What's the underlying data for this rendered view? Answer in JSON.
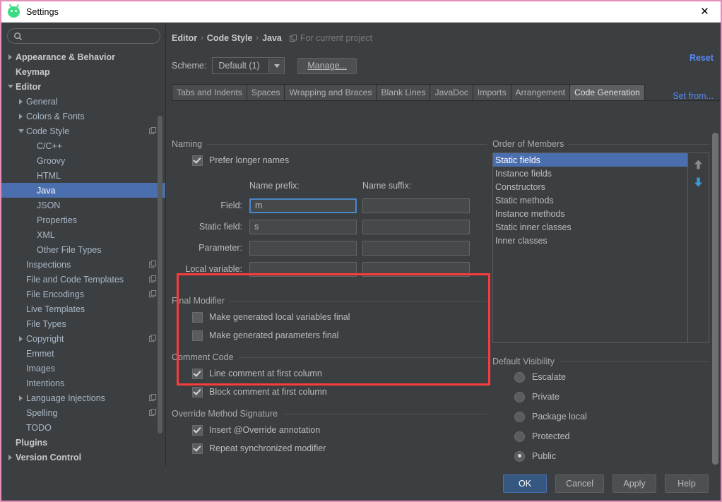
{
  "window": {
    "title": "Settings",
    "app_icon": "android-studio-icon",
    "close_icon": "close-icon",
    "border_color": "#e48fb8"
  },
  "search": {
    "value": "",
    "placeholder": "",
    "icon": "search-icon"
  },
  "sidebar": {
    "items": [
      {
        "label": "Appearance & Behavior",
        "depth": 0,
        "arrow": "collapsed",
        "bold": true,
        "selected": false,
        "badge": false
      },
      {
        "label": "Keymap",
        "depth": 0,
        "arrow": "none",
        "bold": true,
        "selected": false,
        "badge": false
      },
      {
        "label": "Editor",
        "depth": 0,
        "arrow": "expanded",
        "bold": true,
        "selected": false,
        "badge": false
      },
      {
        "label": "General",
        "depth": 1,
        "arrow": "collapsed",
        "bold": false,
        "selected": false,
        "badge": false
      },
      {
        "label": "Colors & Fonts",
        "depth": 1,
        "arrow": "collapsed",
        "bold": false,
        "selected": false,
        "badge": false
      },
      {
        "label": "Code Style",
        "depth": 1,
        "arrow": "expanded",
        "bold": false,
        "selected": false,
        "badge": true
      },
      {
        "label": "C/C++",
        "depth": 2,
        "arrow": "none",
        "bold": false,
        "selected": false,
        "badge": false
      },
      {
        "label": "Groovy",
        "depth": 2,
        "arrow": "none",
        "bold": false,
        "selected": false,
        "badge": false
      },
      {
        "label": "HTML",
        "depth": 2,
        "arrow": "none",
        "bold": false,
        "selected": false,
        "badge": false
      },
      {
        "label": "Java",
        "depth": 2,
        "arrow": "none",
        "bold": false,
        "selected": true,
        "badge": false
      },
      {
        "label": "JSON",
        "depth": 2,
        "arrow": "none",
        "bold": false,
        "selected": false,
        "badge": false
      },
      {
        "label": "Properties",
        "depth": 2,
        "arrow": "none",
        "bold": false,
        "selected": false,
        "badge": false
      },
      {
        "label": "XML",
        "depth": 2,
        "arrow": "none",
        "bold": false,
        "selected": false,
        "badge": false
      },
      {
        "label": "Other File Types",
        "depth": 2,
        "arrow": "none",
        "bold": false,
        "selected": false,
        "badge": false
      },
      {
        "label": "Inspections",
        "depth": 1,
        "arrow": "none",
        "bold": false,
        "selected": false,
        "badge": true
      },
      {
        "label": "File and Code Templates",
        "depth": 1,
        "arrow": "none",
        "bold": false,
        "selected": false,
        "badge": true
      },
      {
        "label": "File Encodings",
        "depth": 1,
        "arrow": "none",
        "bold": false,
        "selected": false,
        "badge": true
      },
      {
        "label": "Live Templates",
        "depth": 1,
        "arrow": "none",
        "bold": false,
        "selected": false,
        "badge": false
      },
      {
        "label": "File Types",
        "depth": 1,
        "arrow": "none",
        "bold": false,
        "selected": false,
        "badge": false
      },
      {
        "label": "Copyright",
        "depth": 1,
        "arrow": "collapsed",
        "bold": false,
        "selected": false,
        "badge": true
      },
      {
        "label": "Emmet",
        "depth": 1,
        "arrow": "none",
        "bold": false,
        "selected": false,
        "badge": false
      },
      {
        "label": "Images",
        "depth": 1,
        "arrow": "none",
        "bold": false,
        "selected": false,
        "badge": false
      },
      {
        "label": "Intentions",
        "depth": 1,
        "arrow": "none",
        "bold": false,
        "selected": false,
        "badge": false
      },
      {
        "label": "Language Injections",
        "depth": 1,
        "arrow": "collapsed",
        "bold": false,
        "selected": false,
        "badge": true
      },
      {
        "label": "Spelling",
        "depth": 1,
        "arrow": "none",
        "bold": false,
        "selected": false,
        "badge": true
      },
      {
        "label": "TODO",
        "depth": 1,
        "arrow": "none",
        "bold": false,
        "selected": false,
        "badge": false
      },
      {
        "label": "Plugins",
        "depth": 0,
        "arrow": "none",
        "bold": true,
        "selected": false,
        "badge": false
      },
      {
        "label": "Version Control",
        "depth": 0,
        "arrow": "collapsed",
        "bold": true,
        "selected": false,
        "badge": false
      }
    ]
  },
  "header": {
    "breadcrumb": [
      "Editor",
      "Code Style",
      "Java"
    ],
    "separator": "›",
    "scope_label": "For current project",
    "scope_icon": "copy-badge-icon",
    "reset_link": "Reset",
    "set_from_link": "Set from...",
    "scheme_label": "Scheme:",
    "scheme_value": "Default (1)",
    "manage_button": "Manage..."
  },
  "tabs": [
    {
      "label": "Tabs and Indents",
      "active": false
    },
    {
      "label": "Spaces",
      "active": false
    },
    {
      "label": "Wrapping and Braces",
      "active": false
    },
    {
      "label": "Blank Lines",
      "active": false
    },
    {
      "label": "JavaDoc",
      "active": false
    },
    {
      "label": "Imports",
      "active": false
    },
    {
      "label": "Arrangement",
      "active": false
    },
    {
      "label": "Code Generation",
      "active": true
    }
  ],
  "naming": {
    "section_title": "Naming",
    "prefer_longer_names": {
      "label": "Prefer longer names",
      "checked": true
    },
    "col_prefix": "Name prefix:",
    "col_suffix": "Name suffix:",
    "rows": [
      {
        "label": "Field:",
        "prefix": "m",
        "suffix": "",
        "focused": true
      },
      {
        "label": "Static field:",
        "prefix": "s",
        "suffix": "",
        "focused": false
      },
      {
        "label": "Parameter:",
        "prefix": "",
        "suffix": "",
        "focused": false
      },
      {
        "label": "Local variable:",
        "prefix": "",
        "suffix": "",
        "focused": false
      }
    ],
    "highlight_color": "#fa3c3c"
  },
  "final_modifier": {
    "section_title": "Final Modifier",
    "options": [
      {
        "label": "Make generated local variables final",
        "checked": false
      },
      {
        "label": "Make generated parameters final",
        "checked": false
      }
    ]
  },
  "comment_code": {
    "section_title": "Comment Code",
    "options": [
      {
        "label": "Line comment at first column",
        "checked": true
      },
      {
        "label": "Block comment at first column",
        "checked": true
      }
    ]
  },
  "override_method_signature": {
    "section_title": "Override Method Signature",
    "options": [
      {
        "label": "Insert @Override annotation",
        "checked": true
      },
      {
        "label": "Repeat synchronized modifier",
        "checked": true
      }
    ]
  },
  "order_of_members": {
    "section_title": "Order of Members",
    "items": [
      {
        "label": "Static fields",
        "selected": true
      },
      {
        "label": "Instance fields",
        "selected": false
      },
      {
        "label": "Constructors",
        "selected": false
      },
      {
        "label": "Static methods",
        "selected": false
      },
      {
        "label": "Instance methods",
        "selected": false
      },
      {
        "label": "Static inner classes",
        "selected": false
      },
      {
        "label": "Inner classes",
        "selected": false
      }
    ],
    "up_icon": "arrow-up-icon",
    "down_icon": "arrow-down-icon",
    "up_enabled": false,
    "down_enabled": true,
    "up_color": "#8a8d8f",
    "down_color": "#3d9ad9"
  },
  "default_visibility": {
    "section_title": "Default Visibility",
    "options": [
      {
        "label": "Escalate",
        "selected": false
      },
      {
        "label": "Private",
        "selected": false
      },
      {
        "label": "Package local",
        "selected": false
      },
      {
        "label": "Protected",
        "selected": false
      },
      {
        "label": "Public",
        "selected": true
      }
    ]
  },
  "footer": {
    "buttons": [
      {
        "label": "OK",
        "default": true
      },
      {
        "label": "Cancel",
        "default": false
      },
      {
        "label": "Apply",
        "default": false
      },
      {
        "label": "Help",
        "default": false
      }
    ]
  }
}
